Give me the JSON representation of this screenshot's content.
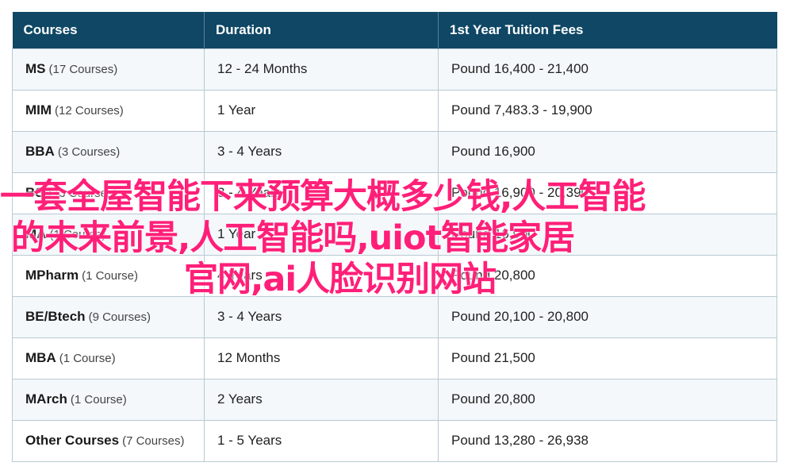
{
  "table": {
    "headers": [
      "Courses",
      "Duration",
      "1st Year Tuition Fees"
    ],
    "rows": [
      {
        "name": "MS",
        "count": "(17 Courses)",
        "duration": "12 - 24 Months",
        "fees": "Pound 16,400 - 21,400"
      },
      {
        "name": "MIM",
        "count": "(12 Courses)",
        "duration": "1 Year",
        "fees": "Pound 7,483.3 - 19,900"
      },
      {
        "name": "BBA",
        "count": "(3 Courses)",
        "duration": "3 - 4 Years",
        "fees": "Pound 16,900"
      },
      {
        "name": "BSc",
        "count": "(3 Courses)",
        "duration": "3 - 4 Years",
        "fees": "Pound 16,900 - 20,390"
      },
      {
        "name": "MA",
        "count": "(1 Course)",
        "duration": "1 Year",
        "fees": "Pound 16,900"
      },
      {
        "name": "MPharm",
        "count": "(1 Course)",
        "duration": "4 Years",
        "fees": "Pound 20,800"
      },
      {
        "name": "BE/Btech",
        "count": "(9 Courses)",
        "duration": "3 - 4 Years",
        "fees": "Pound 20,100 - 20,800"
      },
      {
        "name": "MBA",
        "count": "(1 Course)",
        "duration": "12 Months",
        "fees": "Pound 21,500"
      },
      {
        "name": "MArch",
        "count": "(1 Course)",
        "duration": "2 Years",
        "fees": "Pound 20,800"
      },
      {
        "name": "Other Courses",
        "count": "(7 Courses)",
        "duration": "1 - 5 Years",
        "fees": "Pound 13,280 - 26,938"
      }
    ]
  },
  "overlay": {
    "line1": "一套全屋智能下来预算大概多少钱,人工智能",
    "line2": "的未来前景,人工智能吗,uiot智能家居",
    "line3": "官网,ai人脸识别网站",
    "color": "#ff1f78"
  },
  "colors": {
    "header_bg": "#0f4765",
    "row_alt_bg": "#f4f8fb",
    "border": "#b9c9d3"
  }
}
